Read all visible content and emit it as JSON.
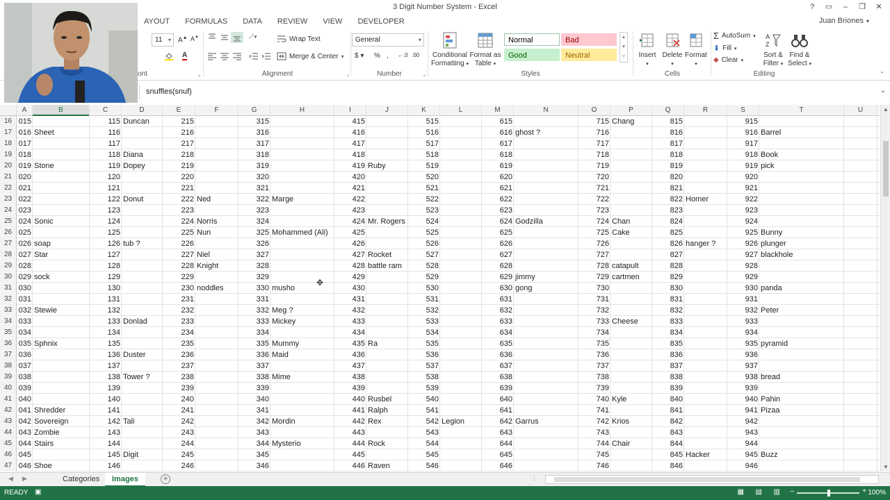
{
  "window": {
    "title": "3 Digit Number System - Excel",
    "user": "Juan Briones",
    "controls": [
      "?",
      "▭",
      "–",
      "❐",
      "✕"
    ]
  },
  "tabs": [
    "AYOUT",
    "FORMULAS",
    "DATA",
    "REVIEW",
    "VIEW",
    "DEVELOPER"
  ],
  "ribbon": {
    "font_size": "11",
    "font_group": "ont",
    "wrap_text": "Wrap Text",
    "merge_center": "Merge & Center",
    "alignment_label": "Alignment",
    "number_format": "General",
    "number_label": "Number",
    "conditional_formatting": [
      "Conditional",
      "Formatting"
    ],
    "format_as_table": [
      "Format as",
      "Table"
    ],
    "styles_label": "Styles",
    "styles": [
      {
        "name": "Normal",
        "bg": "#ffffff",
        "fg": "#000000",
        "border": "#9ec5a8"
      },
      {
        "name": "Bad",
        "bg": "#ffc7ce",
        "fg": "#9c0006",
        "border": "#ffc7ce"
      },
      {
        "name": "Good",
        "bg": "#c6efce",
        "fg": "#006100",
        "border": "#c6efce"
      },
      {
        "name": "Neutral",
        "bg": "#ffeb9c",
        "fg": "#9c6500",
        "border": "#ffeb9c"
      }
    ],
    "insert": "Insert",
    "delete": "Delete",
    "format": "Format",
    "cells_label": "Cells",
    "autosum": "AutoSum",
    "fill": "Fill",
    "clear": "Clear",
    "sort_filter": [
      "Sort &",
      "Filter"
    ],
    "find_select": [
      "Find &",
      "Select"
    ],
    "editing_label": "Editing"
  },
  "formula_bar": {
    "content": "snuffles(snuf)"
  },
  "columns": [
    "A",
    "B",
    "C",
    "D",
    "E",
    "F",
    "G",
    "H",
    "I",
    "J",
    "K",
    "L",
    "M",
    "N",
    "O",
    "P",
    "Q",
    "R",
    "S",
    "T",
    "U",
    "V"
  ],
  "active_column": "B",
  "rows": [
    {
      "r": "16",
      "c": [
        "015",
        "",
        "115",
        "Duncan",
        "215",
        "",
        "315",
        "",
        "415",
        "",
        "515",
        "",
        "615",
        "",
        "715",
        "Chang",
        "815",
        "",
        "915",
        ""
      ]
    },
    {
      "r": "17",
      "c": [
        "016",
        "Sheet",
        "116",
        "",
        "216",
        "",
        "316",
        "",
        "416",
        "",
        "516",
        "",
        "616",
        "ghost ?",
        "716",
        "",
        "816",
        "",
        "916",
        "Barrel"
      ]
    },
    {
      "r": "18",
      "c": [
        "017",
        "",
        "117",
        "",
        "217",
        "",
        "317",
        "",
        "417",
        "",
        "517",
        "",
        "617",
        "",
        "717",
        "",
        "817",
        "",
        "917",
        ""
      ]
    },
    {
      "r": "19",
      "c": [
        "018",
        "",
        "118",
        "Diana",
        "218",
        "",
        "318",
        "",
        "418",
        "",
        "518",
        "",
        "618",
        "",
        "718",
        "",
        "818",
        "",
        "918",
        "Book"
      ]
    },
    {
      "r": "20",
      "c": [
        "019",
        "Stone",
        "119",
        "Dopey",
        "219",
        "",
        "319",
        "",
        "419",
        "Ruby",
        "519",
        "",
        "619",
        "",
        "719",
        "",
        "819",
        "",
        "919",
        "pick"
      ]
    },
    {
      "r": "21",
      "c": [
        "020",
        "",
        "120",
        "",
        "220",
        "",
        "320",
        "",
        "420",
        "",
        "520",
        "",
        "620",
        "",
        "720",
        "",
        "820",
        "",
        "920",
        ""
      ]
    },
    {
      "r": "22",
      "c": [
        "021",
        "",
        "121",
        "",
        "221",
        "",
        "321",
        "",
        "421",
        "",
        "521",
        "",
        "621",
        "",
        "721",
        "",
        "821",
        "",
        "921",
        ""
      ]
    },
    {
      "r": "23",
      "c": [
        "022",
        "",
        "122",
        "Donut",
        "222",
        "Ned",
        "322",
        "Marge",
        "422",
        "",
        "522",
        "",
        "622",
        "",
        "722",
        "",
        "822",
        "Homer",
        "922",
        ""
      ]
    },
    {
      "r": "24",
      "c": [
        "023",
        "",
        "123",
        "",
        "223",
        "",
        "323",
        "",
        "423",
        "",
        "523",
        "",
        "623",
        "",
        "723",
        "",
        "823",
        "",
        "923",
        ""
      ]
    },
    {
      "r": "25",
      "c": [
        "024",
        "Sonic",
        "124",
        "",
        "224",
        "Norris",
        "324",
        "",
        "424",
        "Mr. Rogers",
        "524",
        "",
        "624",
        "Godzilla",
        "724",
        "Chan",
        "824",
        "",
        "924",
        ""
      ]
    },
    {
      "r": "26",
      "c": [
        "025",
        "",
        "125",
        "",
        "225",
        "Nun",
        "325",
        "Mohammed (Ali)",
        "425",
        "",
        "525",
        "",
        "625",
        "",
        "725",
        "Cake",
        "825",
        "",
        "925",
        "Bunny"
      ]
    },
    {
      "r": "27",
      "c": [
        "026",
        "soap",
        "126",
        "tub ?",
        "226",
        "",
        "326",
        "",
        "426",
        "",
        "526",
        "",
        "626",
        "",
        "726",
        "",
        "826",
        "hanger ?",
        "926",
        "plunger"
      ]
    },
    {
      "r": "28",
      "c": [
        "027",
        "Star",
        "127",
        "",
        "227",
        "Niel",
        "327",
        "",
        "427",
        "Rocket",
        "527",
        "",
        "627",
        "",
        "727",
        "",
        "827",
        "",
        "927",
        "blackhole"
      ]
    },
    {
      "r": "29",
      "c": [
        "028",
        "",
        "128",
        "",
        "228",
        "Knight",
        "328",
        "",
        "428",
        "battle ram",
        "528",
        "",
        "628",
        "",
        "728",
        "catapult",
        "828",
        "",
        "928",
        ""
      ]
    },
    {
      "r": "30",
      "c": [
        "029",
        "sock",
        "129",
        "",
        "229",
        "",
        "329",
        "",
        "429",
        "",
        "529",
        "",
        "629",
        "jimmy",
        "729",
        "cartmen",
        "829",
        "",
        "929",
        ""
      ]
    },
    {
      "r": "31",
      "c": [
        "030",
        "",
        "130",
        "",
        "230",
        "noddles",
        "330",
        "musho",
        "430",
        "",
        "530",
        "",
        "630",
        "gong",
        "730",
        "",
        "830",
        "",
        "930",
        "panda"
      ]
    },
    {
      "r": "32",
      "c": [
        "031",
        "",
        "131",
        "",
        "231",
        "",
        "331",
        "",
        "431",
        "",
        "531",
        "",
        "631",
        "",
        "731",
        "",
        "831",
        "",
        "931",
        ""
      ]
    },
    {
      "r": "33",
      "c": [
        "032",
        "Stewie",
        "132",
        "",
        "232",
        "",
        "332",
        "Meg ?",
        "432",
        "",
        "532",
        "",
        "632",
        "",
        "732",
        "",
        "832",
        "",
        "932",
        "Peter"
      ]
    },
    {
      "r": "34",
      "c": [
        "033",
        "",
        "133",
        "Donlad",
        "233",
        "",
        "333",
        "Mickey",
        "433",
        "",
        "533",
        "",
        "633",
        "",
        "733",
        "Cheese",
        "833",
        "",
        "933",
        ""
      ]
    },
    {
      "r": "35",
      "c": [
        "034",
        "",
        "134",
        "",
        "234",
        "",
        "334",
        "",
        "434",
        "",
        "534",
        "",
        "634",
        "",
        "734",
        "",
        "834",
        "",
        "934",
        ""
      ]
    },
    {
      "r": "36",
      "c": [
        "035",
        "Sphnix",
        "135",
        "",
        "235",
        "",
        "335",
        "Mummy",
        "435",
        "Ra",
        "535",
        "",
        "635",
        "",
        "735",
        "",
        "835",
        "",
        "935",
        "pyramid"
      ]
    },
    {
      "r": "37",
      "c": [
        "036",
        "",
        "136",
        "Duster",
        "236",
        "",
        "336",
        "Maid",
        "436",
        "",
        "536",
        "",
        "636",
        "",
        "736",
        "",
        "836",
        "",
        "936",
        ""
      ]
    },
    {
      "r": "38",
      "c": [
        "037",
        "",
        "137",
        "",
        "237",
        "",
        "337",
        "",
        "437",
        "",
        "537",
        "",
        "637",
        "",
        "737",
        "",
        "837",
        "",
        "937",
        ""
      ]
    },
    {
      "r": "39",
      "c": [
        "038",
        "",
        "138",
        "Tower ?",
        "238",
        "",
        "338",
        "Mime",
        "438",
        "",
        "538",
        "",
        "638",
        "",
        "738",
        "",
        "838",
        "",
        "938",
        "bread"
      ]
    },
    {
      "r": "40",
      "c": [
        "039",
        "",
        "139",
        "",
        "239",
        "",
        "339",
        "",
        "439",
        "",
        "539",
        "",
        "639",
        "",
        "739",
        "",
        "839",
        "",
        "939",
        ""
      ]
    },
    {
      "r": "41",
      "c": [
        "040",
        "",
        "140",
        "",
        "240",
        "",
        "340",
        "",
        "440",
        "Rusbel",
        "540",
        "",
        "640",
        "",
        "740",
        "Kyle",
        "840",
        "",
        "940",
        "Pahin"
      ]
    },
    {
      "r": "42",
      "c": [
        "041",
        "Shredder",
        "141",
        "",
        "241",
        "",
        "341",
        "",
        "441",
        "Ralph",
        "541",
        "",
        "641",
        "",
        "741",
        "",
        "841",
        "",
        "941",
        "Pizaa"
      ]
    },
    {
      "r": "43",
      "c": [
        "042",
        "Sovereign",
        "142",
        "Tali",
        "242",
        "",
        "342",
        "Mordin",
        "442",
        "Rex",
        "542",
        "Legion",
        "642",
        "Garrus",
        "742",
        "Krios",
        "842",
        "",
        "942",
        ""
      ]
    },
    {
      "r": "44",
      "c": [
        "043",
        "Zombie",
        "143",
        "",
        "243",
        "",
        "343",
        "",
        "443",
        "",
        "543",
        "",
        "643",
        "",
        "743",
        "",
        "843",
        "",
        "943",
        ""
      ]
    },
    {
      "r": "45",
      "c": [
        "044",
        "Stairs",
        "144",
        "",
        "244",
        "",
        "344",
        "Mysterio",
        "444",
        "Rock",
        "544",
        "",
        "644",
        "",
        "744",
        "Chair",
        "844",
        "",
        "944",
        ""
      ]
    },
    {
      "r": "46",
      "c": [
        "045",
        "",
        "145",
        "Digit",
        "245",
        "",
        "345",
        "",
        "445",
        "",
        "545",
        "",
        "645",
        "",
        "745",
        "",
        "845",
        "Hacker",
        "945",
        "Buzz"
      ]
    },
    {
      "r": "47",
      "c": [
        "046",
        "Shoe",
        "146",
        "",
        "246",
        "",
        "346",
        "",
        "446",
        "Raven",
        "546",
        "",
        "646",
        "",
        "746",
        "",
        "846",
        "",
        "946",
        ""
      ]
    }
  ],
  "sheets": [
    {
      "name": "Categories",
      "active": false
    },
    {
      "name": "Images",
      "active": true
    }
  ],
  "status": {
    "ready": "READY",
    "zoom": "100%"
  }
}
